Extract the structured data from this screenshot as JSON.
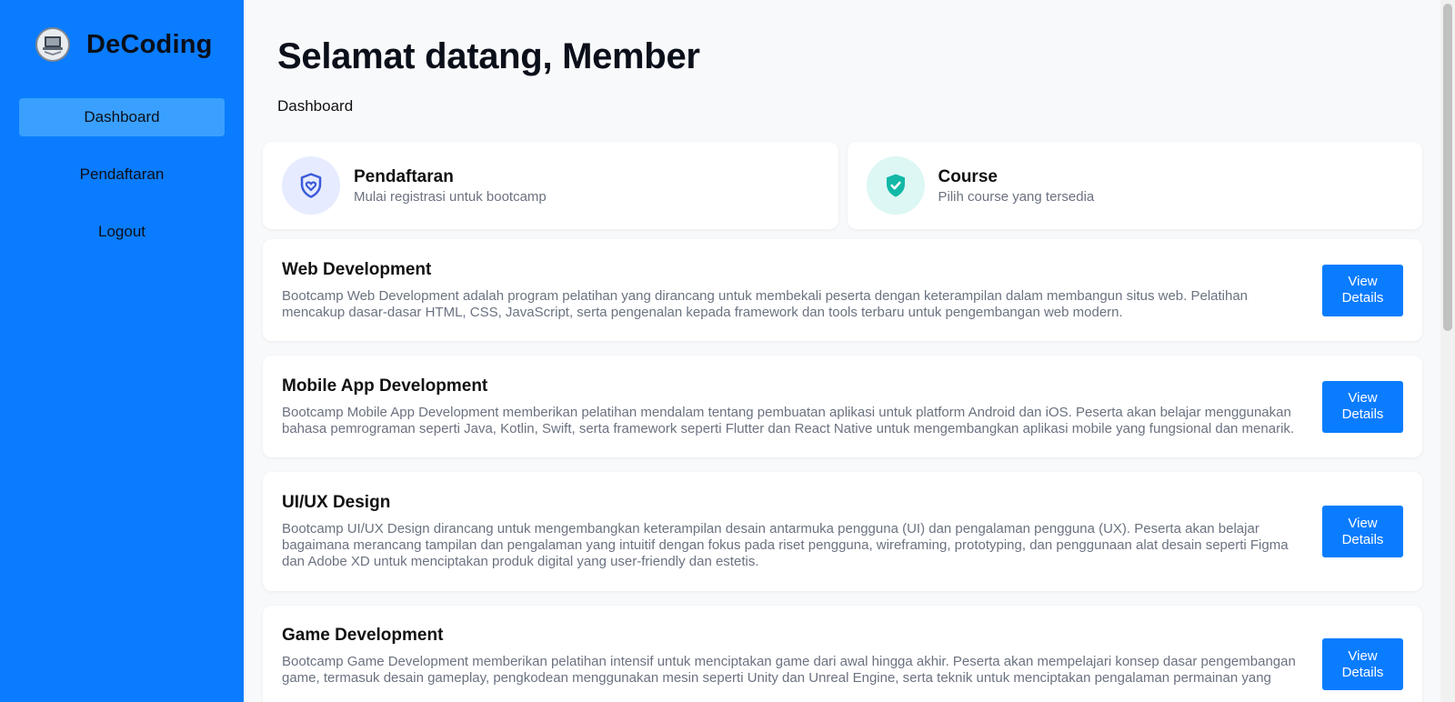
{
  "brand": {
    "name": "DeCoding",
    "logo_icon": "laptop-book-icon"
  },
  "sidebar": {
    "items": [
      {
        "label": "Dashboard",
        "active": true
      },
      {
        "label": "Pendaftaran",
        "active": false
      },
      {
        "label": "Logout",
        "active": false
      }
    ]
  },
  "header": {
    "title": "Selamat datang, Member",
    "breadcrumb": "Dashboard"
  },
  "stats": [
    {
      "title": "Pendaftaran",
      "subtitle": "Mulai registrasi untuk bootcamp",
      "icon": "shield-heart-icon",
      "color": "#3b5bdb"
    },
    {
      "title": "Course",
      "subtitle": "Pilih course yang tersedia",
      "icon": "shield-check-icon",
      "color": "#12b8a6"
    }
  ],
  "courses": [
    {
      "title": "Web Development",
      "description": "Bootcamp Web Development adalah program pelatihan yang dirancang untuk membekali peserta dengan keterampilan dalam membangun situs web. Pelatihan mencakup dasar-dasar HTML, CSS, JavaScript, serta pengenalan kepada framework dan tools terbaru untuk pengembangan web modern.",
      "button": "View Details"
    },
    {
      "title": "Mobile App Development",
      "description": "Bootcamp Mobile App Development memberikan pelatihan mendalam tentang pembuatan aplikasi untuk platform Android dan iOS. Peserta akan belajar menggunakan bahasa pemrograman seperti Java, Kotlin, Swift, serta framework seperti Flutter dan React Native untuk mengembangkan aplikasi mobile yang fungsional dan menarik.",
      "button": "View Details"
    },
    {
      "title": "UI/UX Design",
      "description": "Bootcamp UI/UX Design dirancang untuk mengembangkan keterampilan desain antarmuka pengguna (UI) dan pengalaman pengguna (UX). Peserta akan belajar bagaimana merancang tampilan dan pengalaman yang intuitif dengan fokus pada riset pengguna, wireframing, prototyping, dan penggunaan alat desain seperti Figma dan Adobe XD untuk menciptakan produk digital yang user-friendly dan estetis.",
      "button": "View Details"
    },
    {
      "title": "Game Development",
      "description": "Bootcamp Game Development memberikan pelatihan intensif untuk menciptakan game dari awal hingga akhir. Peserta akan mempelajari konsep dasar pengembangan game, termasuk desain gameplay, pengkodean menggunakan mesin seperti Unity dan Unreal Engine, serta teknik untuk menciptakan pengalaman permainan yang",
      "button": "View Details"
    }
  ],
  "colors": {
    "sidebar": "#0a7cff",
    "active_nav": "#3aa0ff",
    "button": "#0a7cff"
  }
}
